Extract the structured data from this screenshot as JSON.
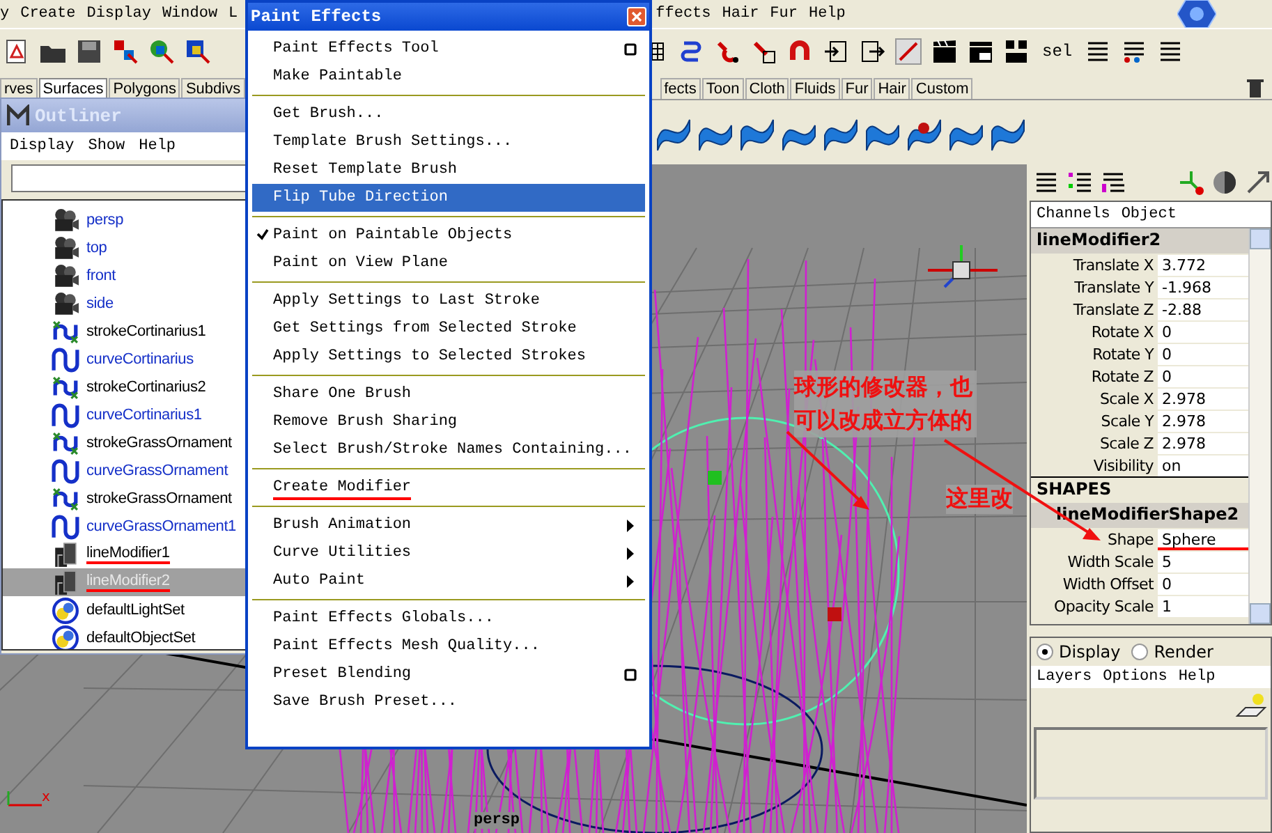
{
  "menubar": {
    "items_left": [
      "y",
      "Create",
      "Display",
      "Window",
      "L"
    ],
    "items_right": [
      "ffects",
      "Hair",
      "Fur",
      "Help"
    ]
  },
  "toolbar": {
    "selection_field": "sel"
  },
  "shelf": {
    "tabs_left": [
      {
        "label": "rves",
        "selected": false
      },
      {
        "label": "Surfaces",
        "selected": true
      },
      {
        "label": "Polygons",
        "selected": false
      },
      {
        "label": "Subdivs",
        "selected": false
      }
    ],
    "tabs_right": [
      {
        "label": "fects",
        "selected": false
      },
      {
        "label": "Toon",
        "selected": false
      },
      {
        "label": "Cloth",
        "selected": false
      },
      {
        "label": "Fluids",
        "selected": false
      },
      {
        "label": "Fur",
        "selected": false
      },
      {
        "label": "Hair",
        "selected": false
      },
      {
        "label": "Custom",
        "selected": false
      }
    ]
  },
  "outliner": {
    "title": "Outliner",
    "menu": [
      "Display",
      "Show",
      "Help"
    ],
    "items": [
      {
        "label": "persp",
        "kind": "camera",
        "selected": false,
        "underlined": false
      },
      {
        "label": "top",
        "kind": "camera",
        "selected": false,
        "underlined": false
      },
      {
        "label": "front",
        "kind": "camera",
        "selected": false,
        "underlined": false
      },
      {
        "label": "side",
        "kind": "camera",
        "selected": false,
        "underlined": false
      },
      {
        "label": "strokeCortinarius1",
        "kind": "stroke",
        "selected": false,
        "underlined": false
      },
      {
        "label": "curveCortinarius",
        "kind": "curve",
        "selected": false,
        "underlined": false
      },
      {
        "label": "strokeCortinarius2",
        "kind": "stroke",
        "selected": false,
        "underlined": false
      },
      {
        "label": "curveCortinarius1",
        "kind": "curve",
        "selected": false,
        "underlined": false
      },
      {
        "label": "strokeGrassOrnament",
        "kind": "stroke",
        "selected": false,
        "underlined": false
      },
      {
        "label": "curveGrassOrnament",
        "kind": "curve",
        "selected": false,
        "underlined": false
      },
      {
        "label": "strokeGrassOrnament",
        "kind": "stroke",
        "selected": false,
        "underlined": false
      },
      {
        "label": "curveGrassOrnament1",
        "kind": "curve",
        "selected": false,
        "underlined": false
      },
      {
        "label": "lineModifier1",
        "kind": "modifier",
        "selected": false,
        "underlined": true
      },
      {
        "label": "lineModifier2",
        "kind": "modifier",
        "selected": true,
        "underlined": true
      },
      {
        "label": "defaultLightSet",
        "kind": "set",
        "selected": false,
        "underlined": false
      },
      {
        "label": "defaultObjectSet",
        "kind": "set",
        "selected": false,
        "underlined": false
      }
    ]
  },
  "paint_effects_menu": {
    "title": "Paint Effects",
    "sections": [
      [
        {
          "label": "Paint Effects Tool",
          "kind": "option",
          "checked": false,
          "highlighted": false,
          "underlined": false
        },
        {
          "label": "Make Paintable",
          "kind": "plain",
          "checked": false,
          "highlighted": false,
          "underlined": false
        }
      ],
      [
        {
          "label": "Get Brush...",
          "kind": "plain",
          "checked": false,
          "highlighted": false,
          "underlined": false
        },
        {
          "label": "Template Brush Settings...",
          "kind": "plain",
          "checked": false,
          "highlighted": false,
          "underlined": false
        },
        {
          "label": "Reset Template Brush",
          "kind": "plain",
          "checked": false,
          "highlighted": false,
          "underlined": false
        },
        {
          "label": "Flip Tube Direction",
          "kind": "plain",
          "checked": false,
          "highlighted": true,
          "underlined": false
        }
      ],
      [
        {
          "label": "Paint on Paintable Objects",
          "kind": "plain",
          "checked": true,
          "highlighted": false,
          "underlined": false
        },
        {
          "label": "Paint on View Plane",
          "kind": "plain",
          "checked": false,
          "highlighted": false,
          "underlined": false
        }
      ],
      [
        {
          "label": "Apply Settings to Last Stroke",
          "kind": "plain",
          "checked": false,
          "highlighted": false,
          "underlined": false
        },
        {
          "label": "Get Settings from Selected Stroke",
          "kind": "plain",
          "checked": false,
          "highlighted": false,
          "underlined": false
        },
        {
          "label": "Apply Settings to Selected Strokes",
          "kind": "plain",
          "checked": false,
          "highlighted": false,
          "underlined": false
        }
      ],
      [
        {
          "label": "Share One Brush",
          "kind": "plain",
          "checked": false,
          "highlighted": false,
          "underlined": false
        },
        {
          "label": "Remove Brush Sharing",
          "kind": "plain",
          "checked": false,
          "highlighted": false,
          "underlined": false
        },
        {
          "label": "Select Brush/Stroke Names Containing...",
          "kind": "plain",
          "checked": false,
          "highlighted": false,
          "underlined": false
        }
      ],
      [
        {
          "label": "Create Modifier",
          "kind": "plain",
          "checked": false,
          "highlighted": false,
          "underlined": true
        }
      ],
      [
        {
          "label": "Brush Animation",
          "kind": "submenu",
          "checked": false,
          "highlighted": false,
          "underlined": false
        },
        {
          "label": "Curve Utilities",
          "kind": "submenu",
          "checked": false,
          "highlighted": false,
          "underlined": false
        },
        {
          "label": "Auto Paint",
          "kind": "submenu",
          "checked": false,
          "highlighted": false,
          "underlined": false
        }
      ],
      [
        {
          "label": "Paint Effects Globals...",
          "kind": "plain",
          "checked": false,
          "highlighted": false,
          "underlined": false
        },
        {
          "label": "Paint Effects Mesh Quality...",
          "kind": "plain",
          "checked": false,
          "highlighted": false,
          "underlined": false
        },
        {
          "label": "Preset Blending",
          "kind": "option",
          "checked": false,
          "highlighted": false,
          "underlined": false
        },
        {
          "label": "Save Brush Preset...",
          "kind": "plain",
          "checked": false,
          "highlighted": false,
          "underlined": false
        }
      ]
    ]
  },
  "viewport": {
    "label": "persp",
    "axis_label": "x",
    "notes": [
      "球形的修改器，也可以改成立方体的",
      "这里改"
    ]
  },
  "channel_box": {
    "menu": [
      "Channels",
      "Object"
    ],
    "node": "lineModifier2",
    "channels": [
      {
        "label": "Translate X",
        "value": "3.772",
        "underlined": false
      },
      {
        "label": "Translate Y",
        "value": "-1.968",
        "underlined": false
      },
      {
        "label": "Translate Z",
        "value": "-2.88",
        "underlined": false
      },
      {
        "label": "Rotate X",
        "value": "0",
        "underlined": false
      },
      {
        "label": "Rotate Y",
        "value": "0",
        "underlined": false
      },
      {
        "label": "Rotate Z",
        "value": "0",
        "underlined": false
      },
      {
        "label": "Scale X",
        "value": "2.978",
        "underlined": false
      },
      {
        "label": "Scale Y",
        "value": "2.978",
        "underlined": false
      },
      {
        "label": "Scale Z",
        "value": "2.978",
        "underlined": false
      },
      {
        "label": "Visibility",
        "value": "on",
        "underlined": false
      }
    ],
    "shapes_heading": "SHAPES",
    "shape_node": "lineModifierShape2",
    "shape_channels": [
      {
        "label": "Shape",
        "value": "Sphere",
        "underlined": true
      },
      {
        "label": "Width Scale",
        "value": "5",
        "underlined": false
      },
      {
        "label": "Width Offset",
        "value": "0",
        "underlined": false
      },
      {
        "label": "Opacity Scale",
        "value": "1",
        "underlined": false
      }
    ]
  },
  "layer_editor": {
    "modes": [
      {
        "label": "Display",
        "selected": true
      },
      {
        "label": "Render",
        "selected": false
      }
    ],
    "menu": [
      "Layers",
      "Options",
      "Help"
    ]
  }
}
